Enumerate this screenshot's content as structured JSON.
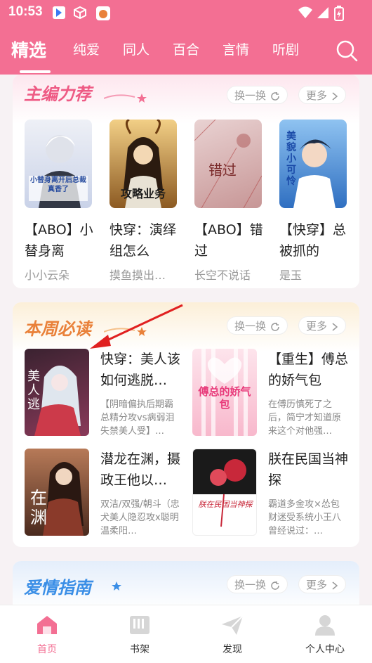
{
  "status": {
    "time": "10:53"
  },
  "tabs": [
    "精选",
    "纯爱",
    "同人",
    "百合",
    "言情",
    "听剧"
  ],
  "sections": [
    {
      "title": "主编力荐",
      "refresh_label": "换一换",
      "more_label": "更多",
      "books": [
        {
          "title": "【ABO】小替身离",
          "author": "小小云朵",
          "cover_text": "小替身离开后总裁真香了"
        },
        {
          "title": "快穿：演绎组怎么",
          "author": "摸鱼摸出…",
          "cover_text": "攻略业务"
        },
        {
          "title": "【ABO】错过",
          "author": "长空不说话",
          "cover_text": "错过"
        },
        {
          "title": "【快穿】总被抓的",
          "author": "是玉",
          "cover_text": "美貌小可怜"
        }
      ]
    },
    {
      "title": "本周必读",
      "refresh_label": "换一换",
      "more_label": "更多",
      "books": [
        {
          "title": "快穿：美人该如何逃脱…",
          "desc": "【阴暗偏执后期霸总精分攻vs病弱泪失禁美人受】…",
          "cover_text": "美人逃"
        },
        {
          "title": "【重生】傅总的娇气包",
          "desc": "在傅历慎死了之后，简宁才知道原来这个对他强…",
          "cover_text": "傅总的娇气包"
        },
        {
          "title": "潜龙在渊，摄政王他以…",
          "desc": "双洁/双强/朝斗（忠犬美人隐忍攻x聪明温柔阳…",
          "cover_text": "在渊"
        },
        {
          "title": "朕在民国当神探",
          "desc": "霸道多金攻×怂包财迷受系统小王八曾经说过：…",
          "cover_text": "朕在民国当神探"
        }
      ]
    },
    {
      "title": "爱情指南",
      "refresh_label": "换一换",
      "more_label": "更多"
    }
  ],
  "bottom_nav": [
    {
      "label": "首页",
      "icon": "home-icon",
      "active": true
    },
    {
      "label": "书架",
      "icon": "bookshelf-icon",
      "active": false
    },
    {
      "label": "发现",
      "icon": "discover-icon",
      "active": false
    },
    {
      "label": "个人中心",
      "icon": "profile-icon",
      "active": false
    }
  ],
  "colors": {
    "accent": "#f36f93",
    "title_pink": "#ee5a84",
    "title_orange": "#e9813a",
    "title_blue": "#3a8ee6"
  }
}
